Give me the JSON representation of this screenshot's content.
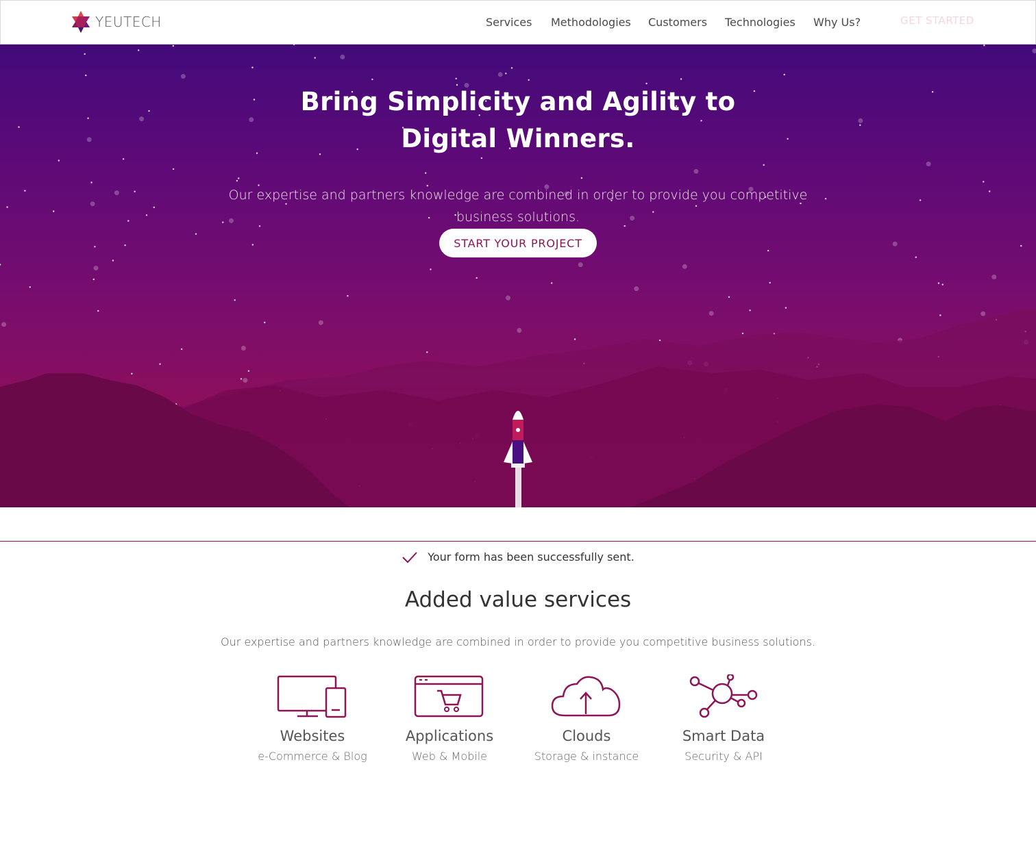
{
  "brand": {
    "name": "YEUTECH",
    "logo_icon": "star-logo-icon"
  },
  "nav": {
    "items": [
      {
        "label": "Services"
      },
      {
        "label": "Methodologies"
      },
      {
        "label": "Customers"
      },
      {
        "label": "Technologies"
      },
      {
        "label": "Why Us?"
      }
    ],
    "cta_label": "GET STARTED"
  },
  "hero": {
    "title_line1": "Bring Simplicity and Agility to",
    "title_line2": "Digital Winners.",
    "subtitle": "Our expertise and partners knowledge are combined in order to provide you competitive business solutions.",
    "cta_label": "START YOUR PROJECT",
    "illustration": "rocket-launch-icon"
  },
  "notice": {
    "icon": "checkmark-icon",
    "text": "Your form has been successfully sent."
  },
  "services": {
    "title": "Added value services",
    "subtitle": "Our expertise and partners knowledge are combined in order to provide you competitive business solutions.",
    "items": [
      {
        "name": "Websites",
        "desc": "e-Commerce & Blog",
        "icon": "devices-icon"
      },
      {
        "name": "Applications",
        "desc": "Web & Mobile",
        "icon": "shopping-cart-window-icon"
      },
      {
        "name": "Clouds",
        "desc": "Storage & instance",
        "icon": "cloud-upload-icon"
      },
      {
        "name": "Smart Data",
        "desc": "Security & API",
        "icon": "network-nodes-icon"
      }
    ]
  },
  "colors": {
    "accent": "#8e1456",
    "hero_top": "#430a7a",
    "hero_bottom": "#951056",
    "mountain_dark": "#6e0b4b"
  }
}
